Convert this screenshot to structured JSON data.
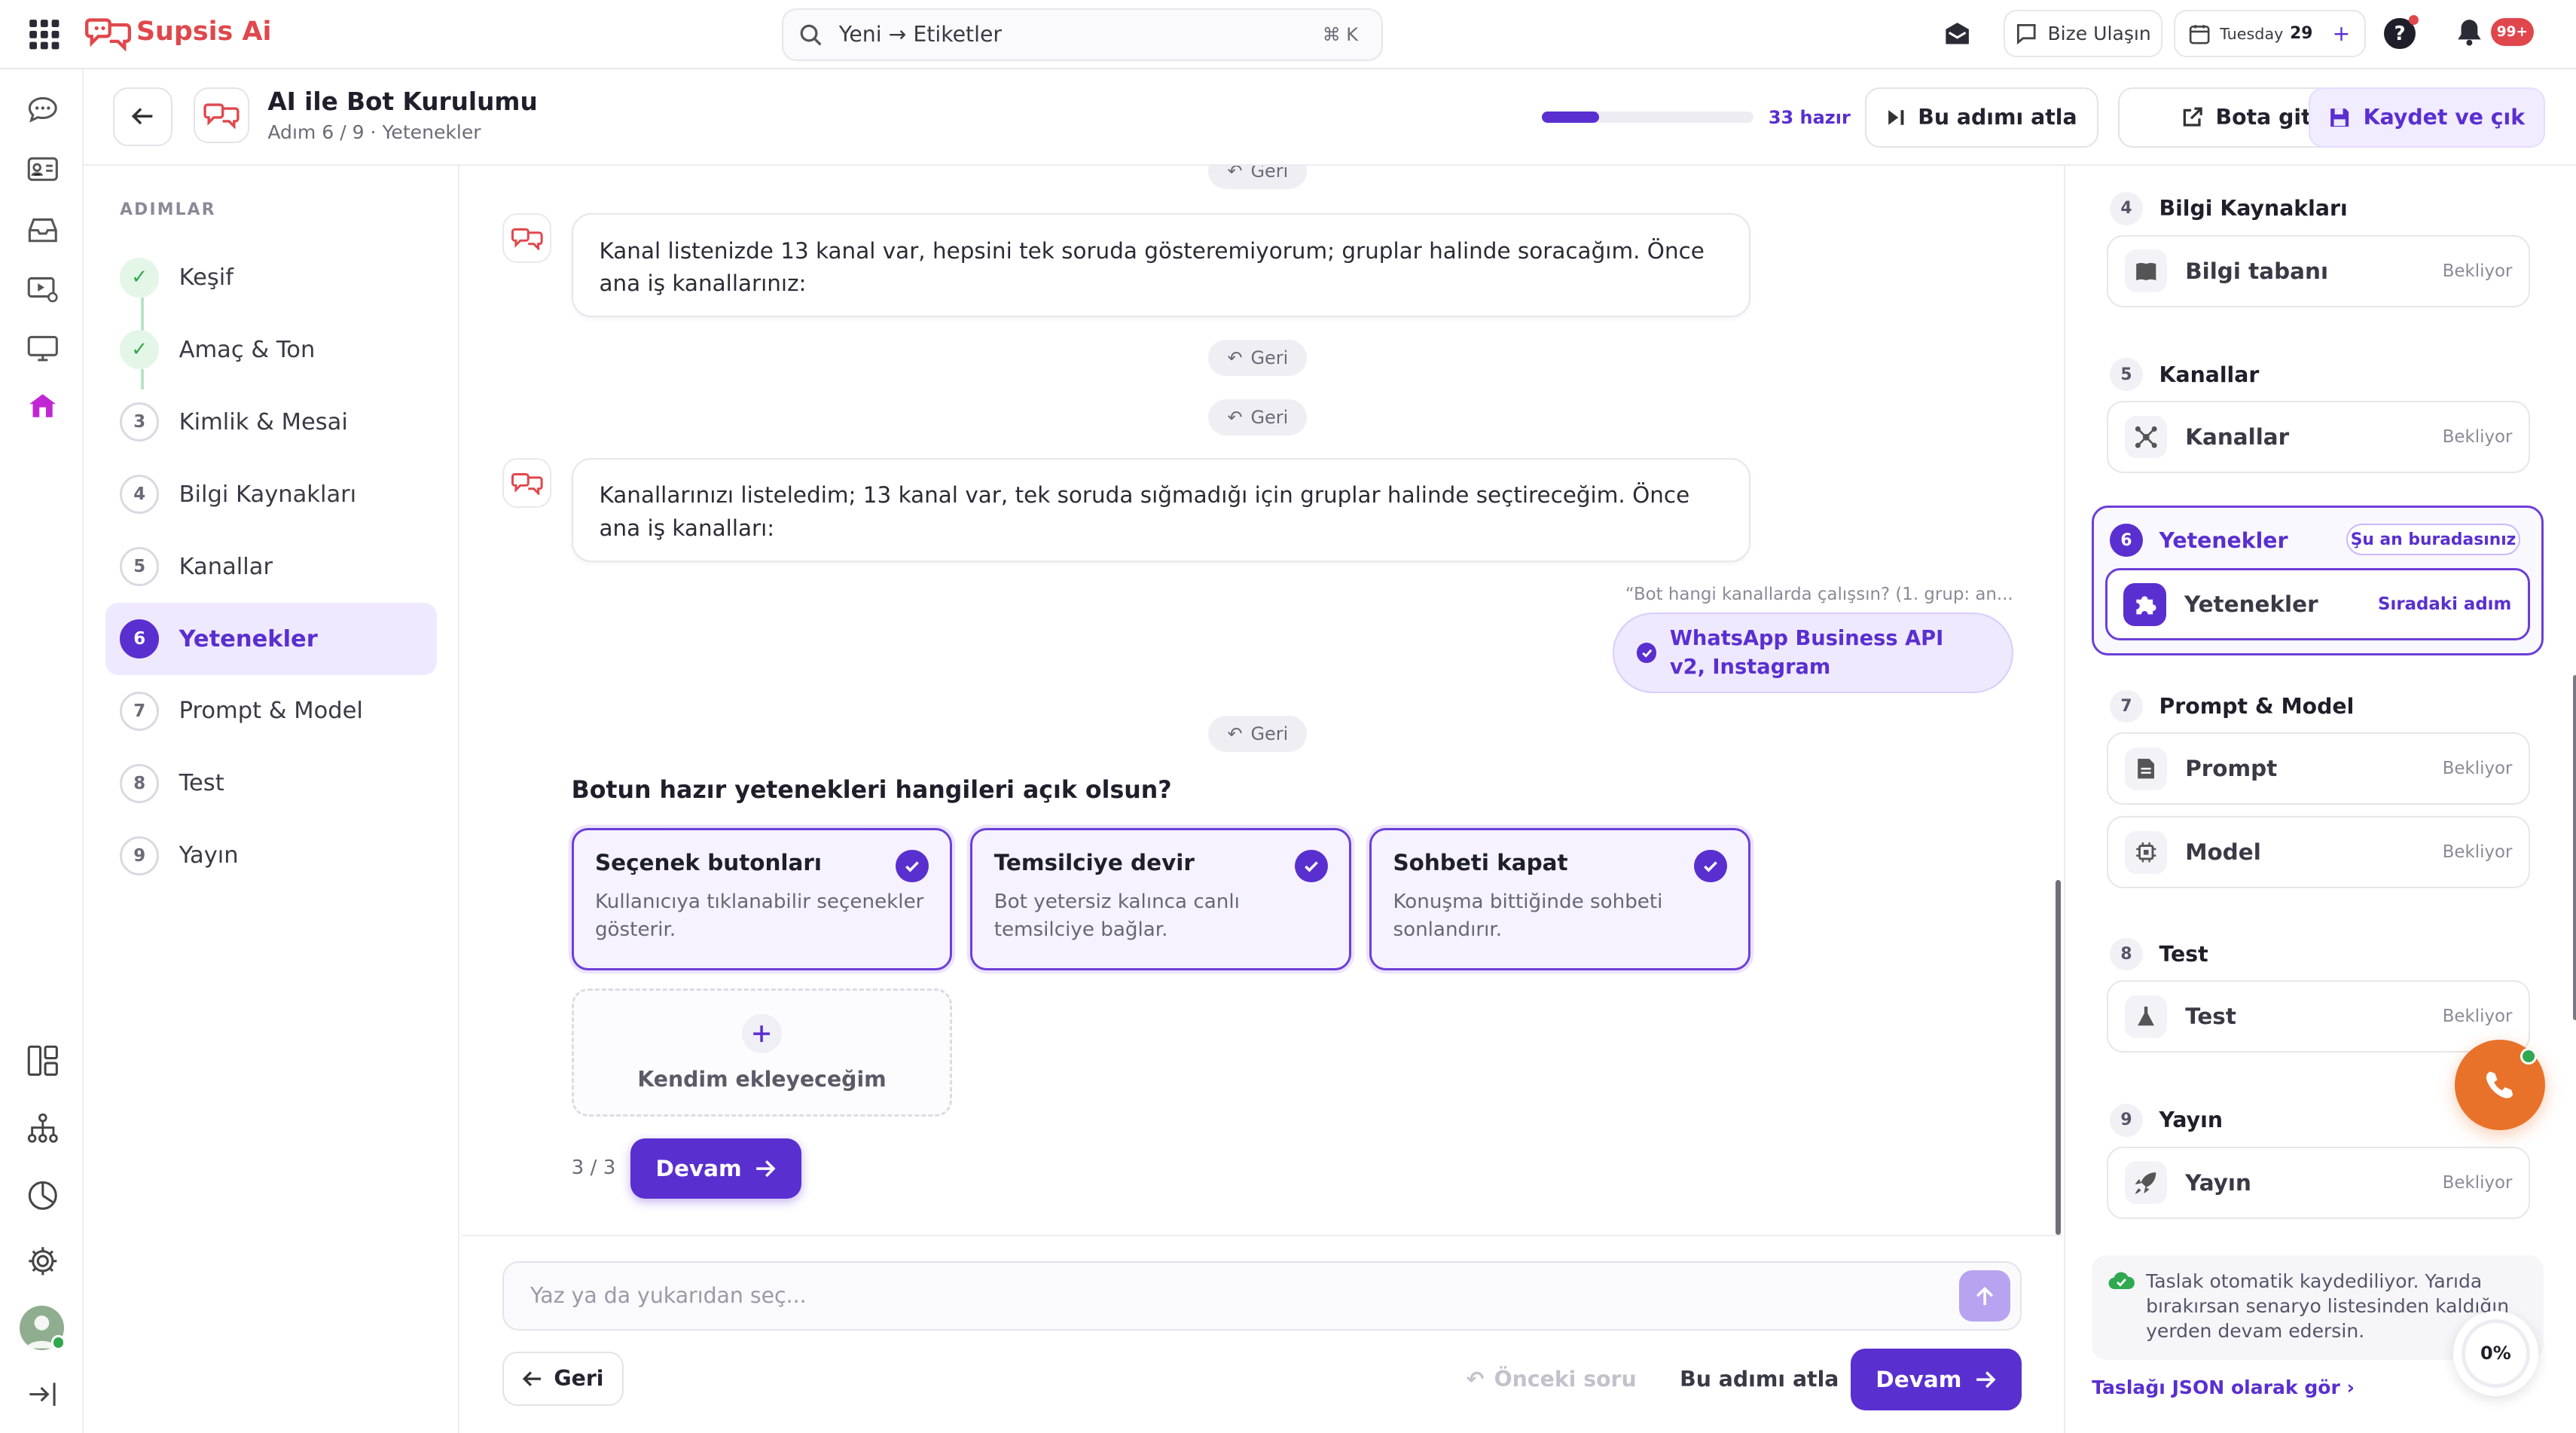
{
  "app": {
    "name": "Supsis Ai"
  },
  "search": {
    "text": "Yeni → Etiketler",
    "shortcut": "⌘ K"
  },
  "topbar": {
    "contact_label": "Bize Ulaşın",
    "date_day": "Tuesday",
    "date_num": "29",
    "notif_badge": "99+"
  },
  "header": {
    "title": "AI ile Bot Kurulumu",
    "subtitle": "Adım 6 / 9 · Yetenekler",
    "progress": 0.27,
    "progress_label": "33 hazır",
    "skip_label": "Bu adımı atla",
    "gotobot_label": "Bota git",
    "save_label": "Kaydet ve çık"
  },
  "steps": {
    "heading": "ADIMLAR",
    "items": [
      {
        "num": "✓",
        "label": "Keşif",
        "state": "done"
      },
      {
        "num": "✓",
        "label": "Amaç & Ton",
        "state": "done"
      },
      {
        "num": "3",
        "label": "Kimlik & Mesai",
        "state": "todo"
      },
      {
        "num": "4",
        "label": "Bilgi Kaynakları",
        "state": "todo"
      },
      {
        "num": "5",
        "label": "Kanallar",
        "state": "todo"
      },
      {
        "num": "6",
        "label": "Yetenekler",
        "state": "active"
      },
      {
        "num": "7",
        "label": "Prompt & Model",
        "state": "todo"
      },
      {
        "num": "8",
        "label": "Test",
        "state": "todo"
      },
      {
        "num": "9",
        "label": "Yayın",
        "state": "todo"
      }
    ]
  },
  "chat": {
    "back_label": "Geri",
    "msg1": "Kanal listenizde 13 kanal var, hepsini tek soruda gösteremiyorum; gruplar halinde soracağım. Önce ana iş kanallarınız:",
    "msg2": "Kanallarınızı listeledim; 13 kanal var, tek soruda sığmadığı için gruplar halinde seçtireceğim. Önce ana iş kanalları:",
    "quote": "“Bot hangi kanallarda çalışsın? (1. grup: an...",
    "answer": "WhatsApp Business API v2, Instagram",
    "question": "Botun hazır yetenekleri hangileri açık olsun?",
    "cards": [
      {
        "title": "Seçenek butonları",
        "desc": "Kullanıcıya tıklanabilir seçenekler gösterir."
      },
      {
        "title": "Temsilciye devir",
        "desc": "Bot yetersiz kalınca canlı temsilciye bağlar."
      },
      {
        "title": "Sohbeti kapat",
        "desc": "Konuşma bittiğinde sohbeti sonlandırır."
      }
    ],
    "custom_label": "Kendim ekleyeceğim",
    "counter": "3 / 3",
    "continue_label": "Devam"
  },
  "composer": {
    "placeholder": "Yaz ya da yukarıdan seç...",
    "back_label": "Geri",
    "prev_label": "Önceki soru",
    "skip_label": "Bu adımı atla",
    "continue_label": "Devam"
  },
  "right": {
    "sections": [
      {
        "num": "4",
        "title": "Bilgi Kaynakları",
        "items": [
          {
            "label": "Bilgi tabanı",
            "status": "Bekliyor",
            "icon": "book-icon"
          }
        ]
      },
      {
        "num": "5",
        "title": "Kanallar",
        "items": [
          {
            "label": "Kanallar",
            "status": "Bekliyor",
            "icon": "network-icon"
          }
        ]
      },
      {
        "num": "6",
        "title": "Yetenekler",
        "badge": "Şu an buradasınız",
        "items": [
          {
            "label": "Yetenekler",
            "status": "Sıradaki adım",
            "icon": "puzzle-icon"
          }
        ]
      },
      {
        "num": "7",
        "title": "Prompt & Model",
        "items": [
          {
            "label": "Prompt",
            "status": "Bekliyor",
            "icon": "document-icon"
          },
          {
            "label": "Model",
            "status": "Bekliyor",
            "icon": "chip-icon"
          }
        ]
      },
      {
        "num": "8",
        "title": "Test",
        "items": [
          {
            "label": "Test",
            "status": "Bekliyor",
            "icon": "flask-icon"
          }
        ]
      },
      {
        "num": "9",
        "title": "Yayın",
        "items": [
          {
            "label": "Yayın",
            "status": "Bekliyor",
            "icon": "rocket-icon"
          }
        ]
      }
    ],
    "autosave_note": "Taslak otomatik kaydediliyor. Yarıda bırakırsan senaryo listesinden kaldığın yerden devam edersin.",
    "json_link": "Taslağı JSON olarak gör ›",
    "percent": "0%"
  },
  "colors": {
    "accent": "#5a2fd0",
    "accent_light": "#f1ecff",
    "brand_red": "#e0474c",
    "call_orange": "#e8722a",
    "success": "#2fa84f"
  }
}
